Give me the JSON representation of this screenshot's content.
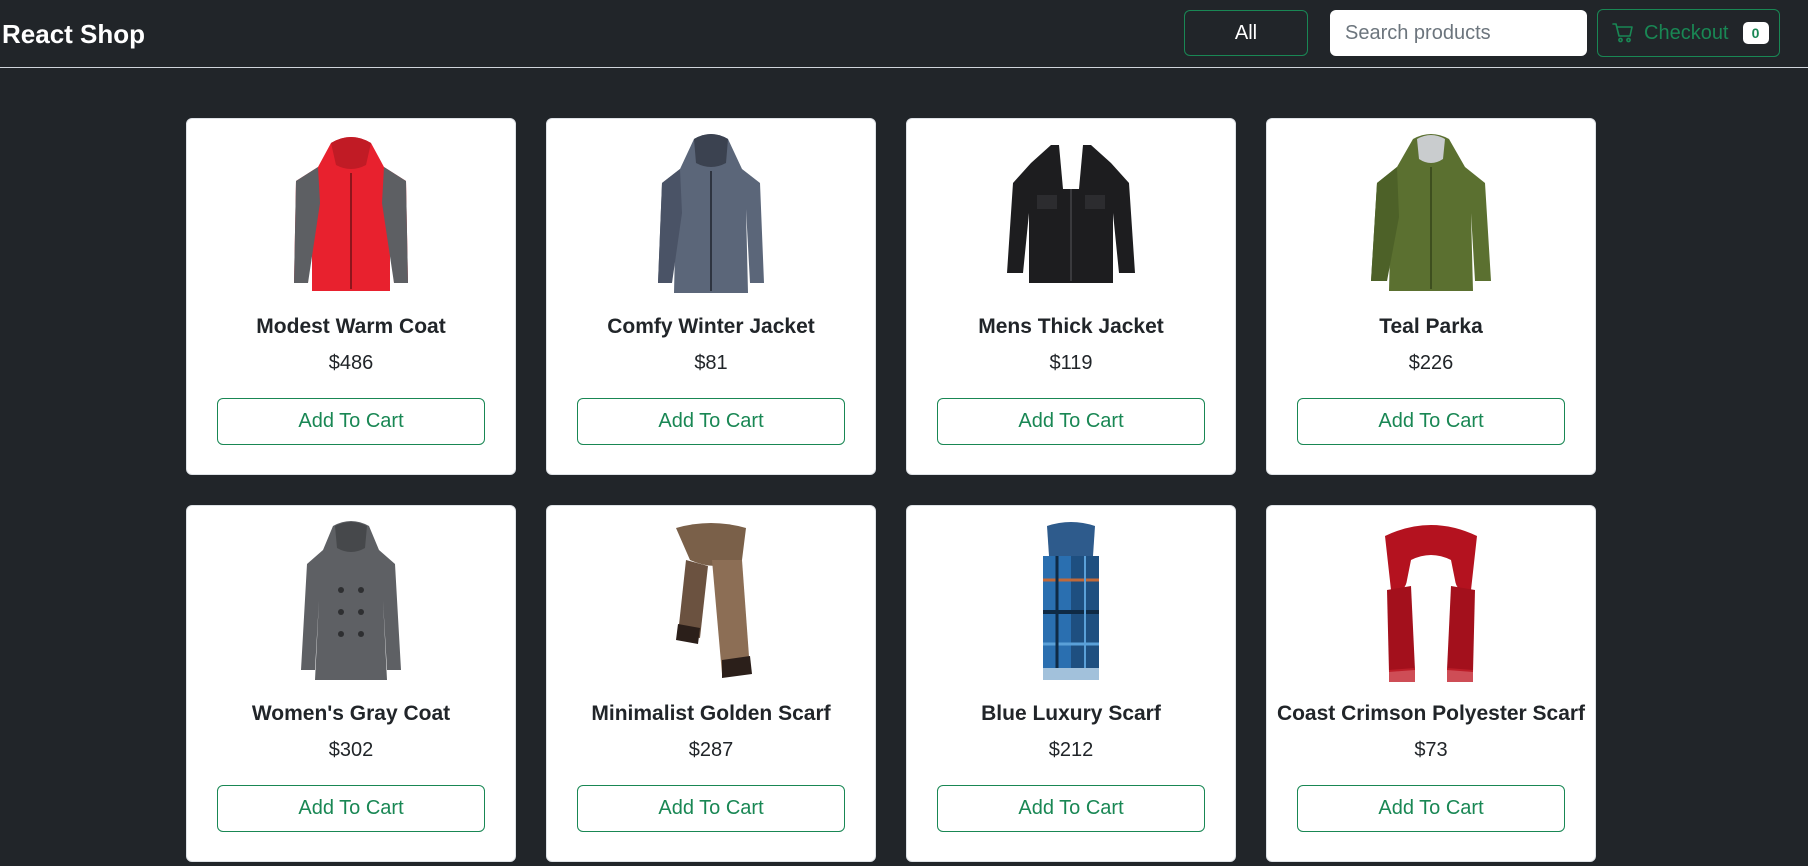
{
  "header": {
    "brand": "React Shop",
    "filter_label": "All",
    "search_placeholder": "Search products",
    "checkout_label": "Checkout",
    "cart_count": "0"
  },
  "colors": {
    "background": "#212529",
    "accent": "#198754",
    "card": "#ffffff"
  },
  "products": [
    {
      "name": "Modest Warm Coat",
      "price": "$486",
      "button": "Add To Cart",
      "icon": "red-jacket-icon"
    },
    {
      "name": "Comfy Winter Jacket",
      "price": "$81",
      "button": "Add To Cart",
      "icon": "gray-blue-jacket-icon"
    },
    {
      "name": "Mens Thick Jacket",
      "price": "$119",
      "button": "Add To Cart",
      "icon": "black-jacket-icon"
    },
    {
      "name": "Teal Parka",
      "price": "$226",
      "button": "Add To Cart",
      "icon": "green-parka-icon"
    },
    {
      "name": "Women's Gray Coat",
      "price": "$302",
      "button": "Add To Cart",
      "icon": "gray-coat-icon"
    },
    {
      "name": "Minimalist Golden Scarf",
      "price": "$287",
      "button": "Add To Cart",
      "icon": "brown-scarf-icon"
    },
    {
      "name": "Blue Luxury Scarf",
      "price": "$212",
      "button": "Add To Cart",
      "icon": "blue-plaid-scarf-icon"
    },
    {
      "name": "Coast Crimson Polyester Scarf",
      "price": "$73",
      "button": "Add To Cart",
      "icon": "crimson-scarf-icon"
    }
  ]
}
